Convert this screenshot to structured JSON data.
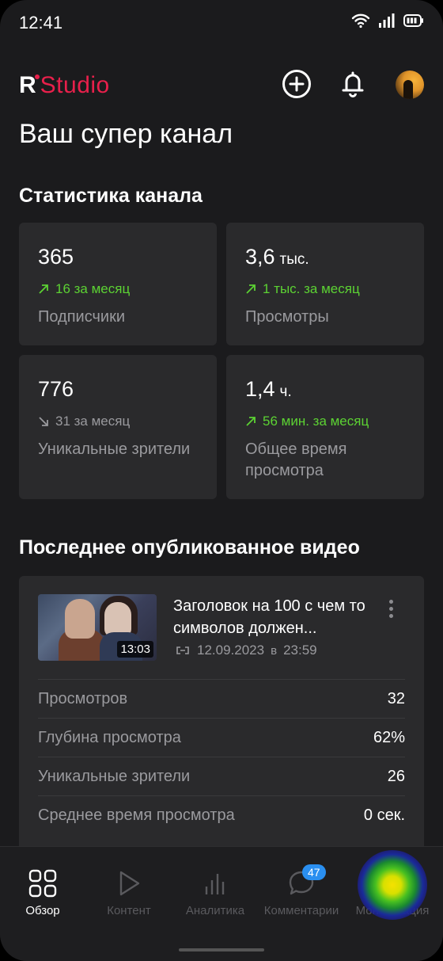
{
  "status_bar": {
    "time": "12:41"
  },
  "header": {
    "logo_r": "R",
    "logo_text": "Studio",
    "icons": [
      "plus-circle-icon",
      "bell-icon"
    ],
    "colors": {
      "brand": "#e8204b",
      "background": "#1b1b1d",
      "card": "#2a2a2c",
      "positive": "#5cd233",
      "muted": "#9a9a9e"
    }
  },
  "page_title": "Ваш супер канал",
  "stats": {
    "title": "Статистика канала",
    "cards": [
      {
        "value": "365",
        "unit": "",
        "delta": "16 за месяц",
        "direction": "up",
        "label": "Подписчики"
      },
      {
        "value": "3,6",
        "unit": "тыс.",
        "delta": "1 тыс. за месяц",
        "direction": "up",
        "label": "Просмотры"
      },
      {
        "value": "776",
        "unit": "",
        "delta": "31 за месяц",
        "direction": "down",
        "label": "Уникальные зрители"
      },
      {
        "value": "1,4",
        "unit": "ч.",
        "delta": "56 мин. за месяц",
        "direction": "up",
        "label": "Общее время просмотра"
      }
    ]
  },
  "latest_video": {
    "title": "Последнее опубликованное видео",
    "name": "Заголовок на 100 с чем то символов должен...",
    "duration": "13:03",
    "date": "12.09.2023",
    "date_at": "в",
    "time": "23:59",
    "metrics": [
      {
        "label": "Просмотров",
        "value": "32"
      },
      {
        "label": "Глубина просмотра",
        "value": "62%"
      },
      {
        "label": "Уникальные зрители",
        "value": "26"
      },
      {
        "label": "Среднее время просмотра",
        "value": "0 сек."
      }
    ]
  },
  "bottom_nav": {
    "items": [
      {
        "label": "Обзор",
        "icon": "grid-icon",
        "active": true
      },
      {
        "label": "Контент",
        "icon": "play-icon",
        "active": false
      },
      {
        "label": "Аналитика",
        "icon": "bar-chart-icon",
        "active": false
      },
      {
        "label": "Комментарии",
        "icon": "chat-icon",
        "active": false,
        "badge": "47"
      },
      {
        "label": "Монетизация",
        "icon": "coin-icon",
        "active": false
      }
    ]
  }
}
